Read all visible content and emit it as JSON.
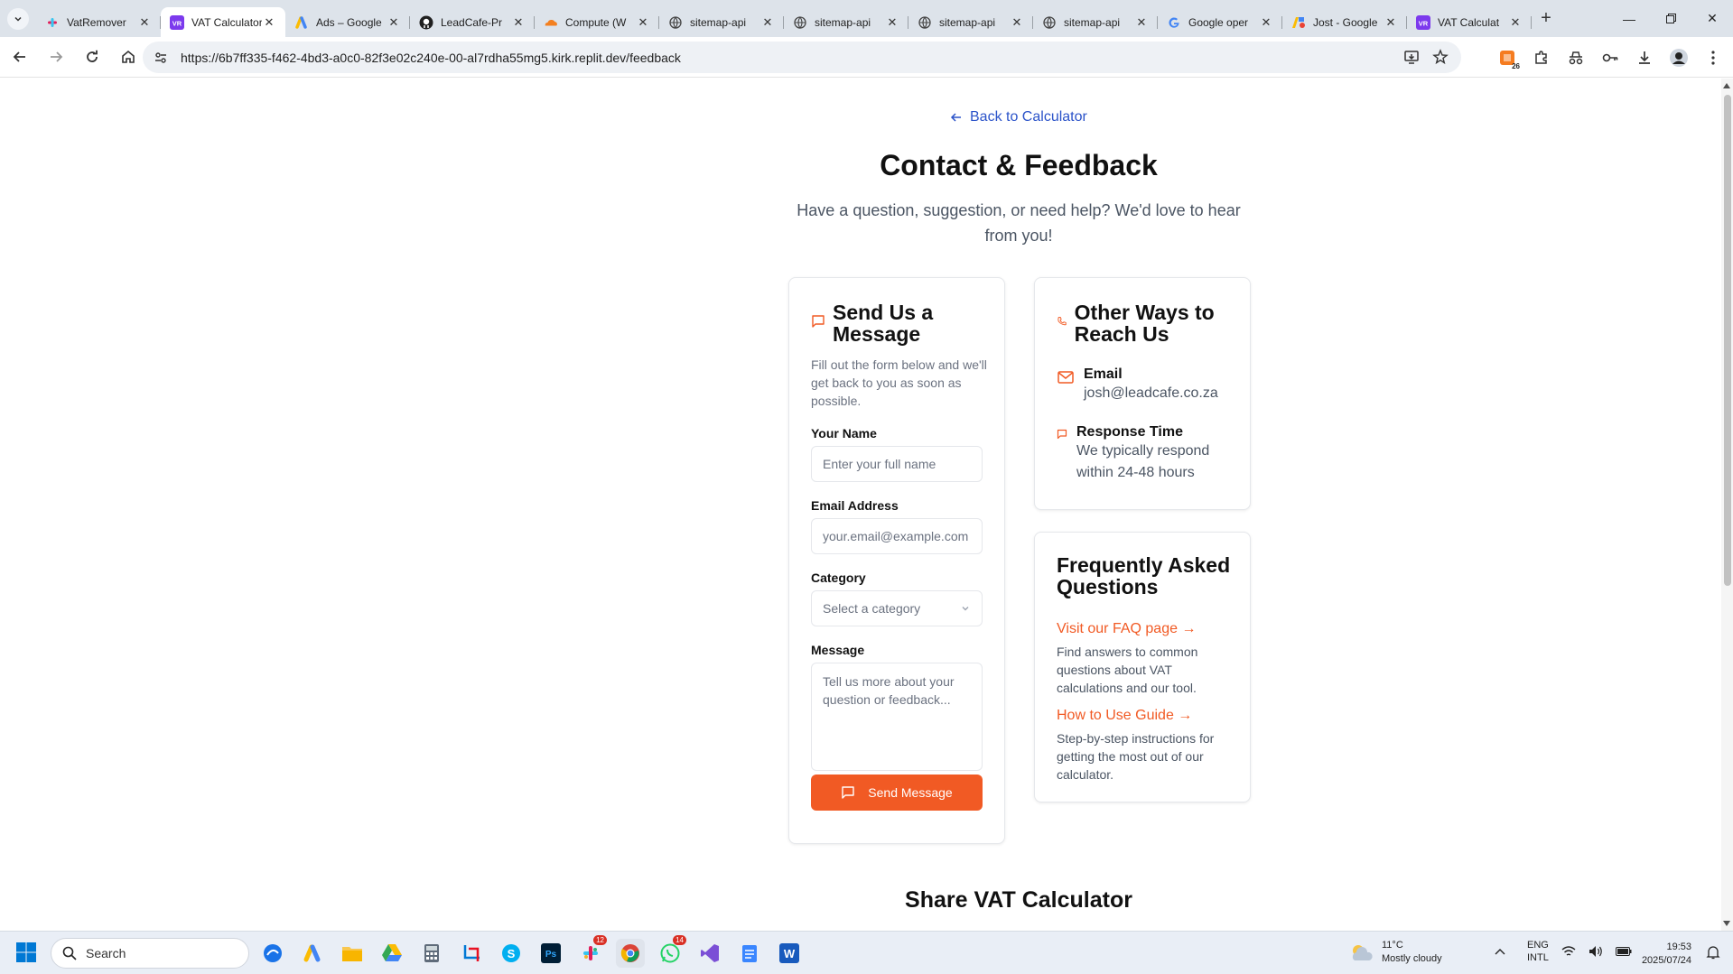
{
  "browser": {
    "tabs": [
      {
        "label": "VatRemover",
        "icon": "slack-like-icon",
        "active": false
      },
      {
        "label": "VAT Calculator",
        "icon": "vr-icon",
        "active": true
      },
      {
        "label": "Ads – Google",
        "icon": "google-ads-icon",
        "active": false
      },
      {
        "label": "LeadCafe-Pr",
        "icon": "github-icon",
        "active": false
      },
      {
        "label": "Compute (W",
        "icon": "cloudflare-icon",
        "active": false
      },
      {
        "label": "sitemap-api",
        "icon": "globe-icon",
        "active": false
      },
      {
        "label": "sitemap-api",
        "icon": "globe-icon",
        "active": false
      },
      {
        "label": "sitemap-api",
        "icon": "globe-icon",
        "active": false
      },
      {
        "label": "sitemap-api",
        "icon": "globe-icon",
        "active": false
      },
      {
        "label": "Google oper",
        "icon": "google-icon",
        "active": false
      },
      {
        "label": "Jost - Google",
        "icon": "google-fonts-icon",
        "active": false
      },
      {
        "label": "VAT Calculat",
        "icon": "vr-icon",
        "active": false
      }
    ],
    "url": "https://6b7ff335-f462-4bd3-a0c0-82f3e02c240e-00-al7rdha55mg5.kirk.replit.dev/feedback",
    "extension_badge": "26"
  },
  "page": {
    "back_link": "Back to Calculator",
    "title": "Contact & Feedback",
    "subtitle": "Have a question, suggestion, or need help? We'd love to hear from you!",
    "form": {
      "heading": "Send Us a Message",
      "description": "Fill out the form below and we'll get back to you as soon as possible.",
      "name_label": "Your Name",
      "name_placeholder": "Enter your full name",
      "email_label": "Email Address",
      "email_placeholder": "your.email@example.com",
      "category_label": "Category",
      "category_placeholder": "Select a category",
      "message_label": "Message",
      "message_placeholder": "Tell us more about your question or feedback...",
      "submit_label": "Send Message"
    },
    "reach": {
      "heading": "Other Ways to Reach Us",
      "email_title": "Email",
      "email_value": "josh@leadcafe.co.za",
      "response_title": "Response Time",
      "response_value": "We typically respond within 24-48 hours"
    },
    "faq": {
      "heading": "Frequently Asked Questions",
      "link1": "Visit our FAQ page →",
      "desc1": "Find answers to common questions about VAT calculations and our tool.",
      "link2": "How to Use Guide →",
      "desc2": "Step-by-step instructions for getting the most out of our calculator."
    },
    "share_title": "Share VAT Calculator",
    "accent_color": "#f15a24",
    "link_color": "#2b53c9"
  },
  "taskbar": {
    "search_label": "Search",
    "slack_count": "12",
    "whatsapp_count": "14",
    "weather_temp": "11°C",
    "weather_desc": "Mostly cloudy",
    "lang_line1": "ENG",
    "lang_line2": "INTL",
    "time": "19:53",
    "date": "2025/07/24"
  }
}
